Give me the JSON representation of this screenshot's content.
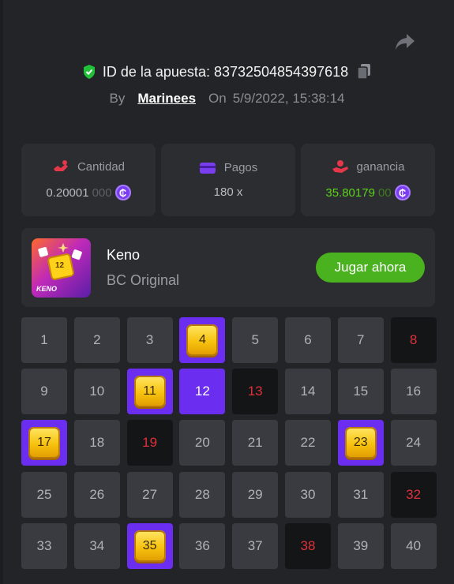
{
  "header": {
    "bet_label": "ID de la apuesta: 83732504854397618",
    "by_label": "By",
    "user": "Marinees",
    "on_label": "On",
    "datetime": "5/9/2022, 15:38:14"
  },
  "stats": {
    "amount": {
      "label": "Cantidad",
      "value_main": "0.20001",
      "value_dim": "000"
    },
    "payout": {
      "label": "Pagos",
      "value": "180 x"
    },
    "profit": {
      "label": "ganancia",
      "value_main": "35.80179",
      "value_dim": "00"
    },
    "coin_symbol": "₵"
  },
  "game": {
    "thumb_number": "12",
    "thumb_text": "KENO",
    "name": "Keno",
    "provider": "BC Original",
    "play_label": "Jugar ahora"
  },
  "grid": {
    "numbers": [
      "1",
      "2",
      "3",
      "4",
      "5",
      "6",
      "7",
      "8",
      "9",
      "10",
      "11",
      "12",
      "13",
      "14",
      "15",
      "16",
      "17",
      "18",
      "19",
      "20",
      "21",
      "22",
      "23",
      "24",
      "25",
      "26",
      "27",
      "28",
      "29",
      "30",
      "31",
      "32",
      "33",
      "34",
      "35",
      "36",
      "37",
      "38",
      "39",
      "40"
    ],
    "hits": [
      "4",
      "11",
      "17",
      "23",
      "35"
    ],
    "selected_no_hit": [
      "12"
    ],
    "drawn_miss": [
      "8",
      "13",
      "19",
      "32",
      "38"
    ]
  },
  "colors": {
    "accent_purple": "#6b2df0",
    "miss_red": "#e0313b",
    "profit_green": "#5cd31a",
    "play_green": "#4ab21e"
  }
}
